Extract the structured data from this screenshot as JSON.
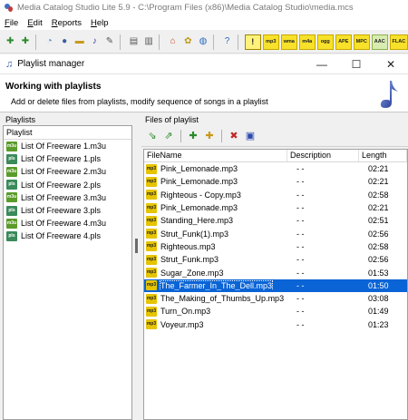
{
  "window": {
    "title": "Media Catalog Studio Lite 5.9 - C:\\Program Files (x86)\\Media Catalog Studio\\media.mcs"
  },
  "menu": [
    "File",
    "Edit",
    "Reports",
    "Help"
  ],
  "format_buttons": [
    "mp3",
    "wma",
    "m4a",
    "ogg",
    "APE",
    "MPC",
    "AAC",
    "FLAC"
  ],
  "dialog": {
    "title": "Playlist manager",
    "controls": {
      "minimize": "—",
      "maximize": "☐",
      "close": "✕"
    },
    "heading": "Working with playlists",
    "subheading": "Add or delete files from playlists, modify sequence of songs in a playlist"
  },
  "playlists": {
    "caption": "Playlists",
    "column": "Playlist",
    "items": [
      {
        "type": "m3u",
        "label": "List Of Freeware 1.m3u"
      },
      {
        "type": "pls",
        "label": "List Of Freeware 1.pls"
      },
      {
        "type": "m3u",
        "label": "List Of Freeware 2.m3u"
      },
      {
        "type": "pls",
        "label": "List Of Freeware 2.pls"
      },
      {
        "type": "m3u",
        "label": "List Of Freeware 3.m3u"
      },
      {
        "type": "pls",
        "label": "List Of Freeware 3.pls"
      },
      {
        "type": "m3u",
        "label": "List Of Freeware 4.m3u"
      },
      {
        "type": "pls",
        "label": "List Of Freeware 4.pls"
      }
    ]
  },
  "files": {
    "caption": "Files of playlist",
    "columns": [
      "FileName",
      "Description",
      "Length"
    ],
    "rows": [
      {
        "name": "Pink_Lemonade.mp3",
        "desc": "- -",
        "length": "02:21",
        "selected": false
      },
      {
        "name": "Pink_Lemonade.mp3",
        "desc": "- -",
        "length": "02:21",
        "selected": false
      },
      {
        "name": "Righteous - Copy.mp3",
        "desc": "- -",
        "length": "02:58",
        "selected": false
      },
      {
        "name": "Pink_Lemonade.mp3",
        "desc": "- -",
        "length": "02:21",
        "selected": false
      },
      {
        "name": "Standing_Here.mp3",
        "desc": "- -",
        "length": "02:51",
        "selected": false
      },
      {
        "name": "Strut_Funk(1).mp3",
        "desc": "- -",
        "length": "02:56",
        "selected": false
      },
      {
        "name": "Righteous.mp3",
        "desc": "- -",
        "length": "02:58",
        "selected": false
      },
      {
        "name": "Strut_Funk.mp3",
        "desc": "- -",
        "length": "02:56",
        "selected": false
      },
      {
        "name": "Sugar_Zone.mp3",
        "desc": "- -",
        "length": "01:53",
        "selected": false
      },
      {
        "name": "The_Farmer_In_The_Dell.mp3",
        "desc": "- -",
        "length": "01:50",
        "selected": true
      },
      {
        "name": "The_Making_of_Thumbs_Up.mp3",
        "desc": "- -",
        "length": "03:08",
        "selected": false
      },
      {
        "name": "Turn_On.mp3",
        "desc": "- -",
        "length": "01:49",
        "selected": false
      },
      {
        "name": "Voyeur.mp3",
        "desc": "- -",
        "length": "01:23",
        "selected": false
      }
    ]
  },
  "colors": {
    "selection": "#0a64d6",
    "format_yellow": "#f7e12a"
  }
}
